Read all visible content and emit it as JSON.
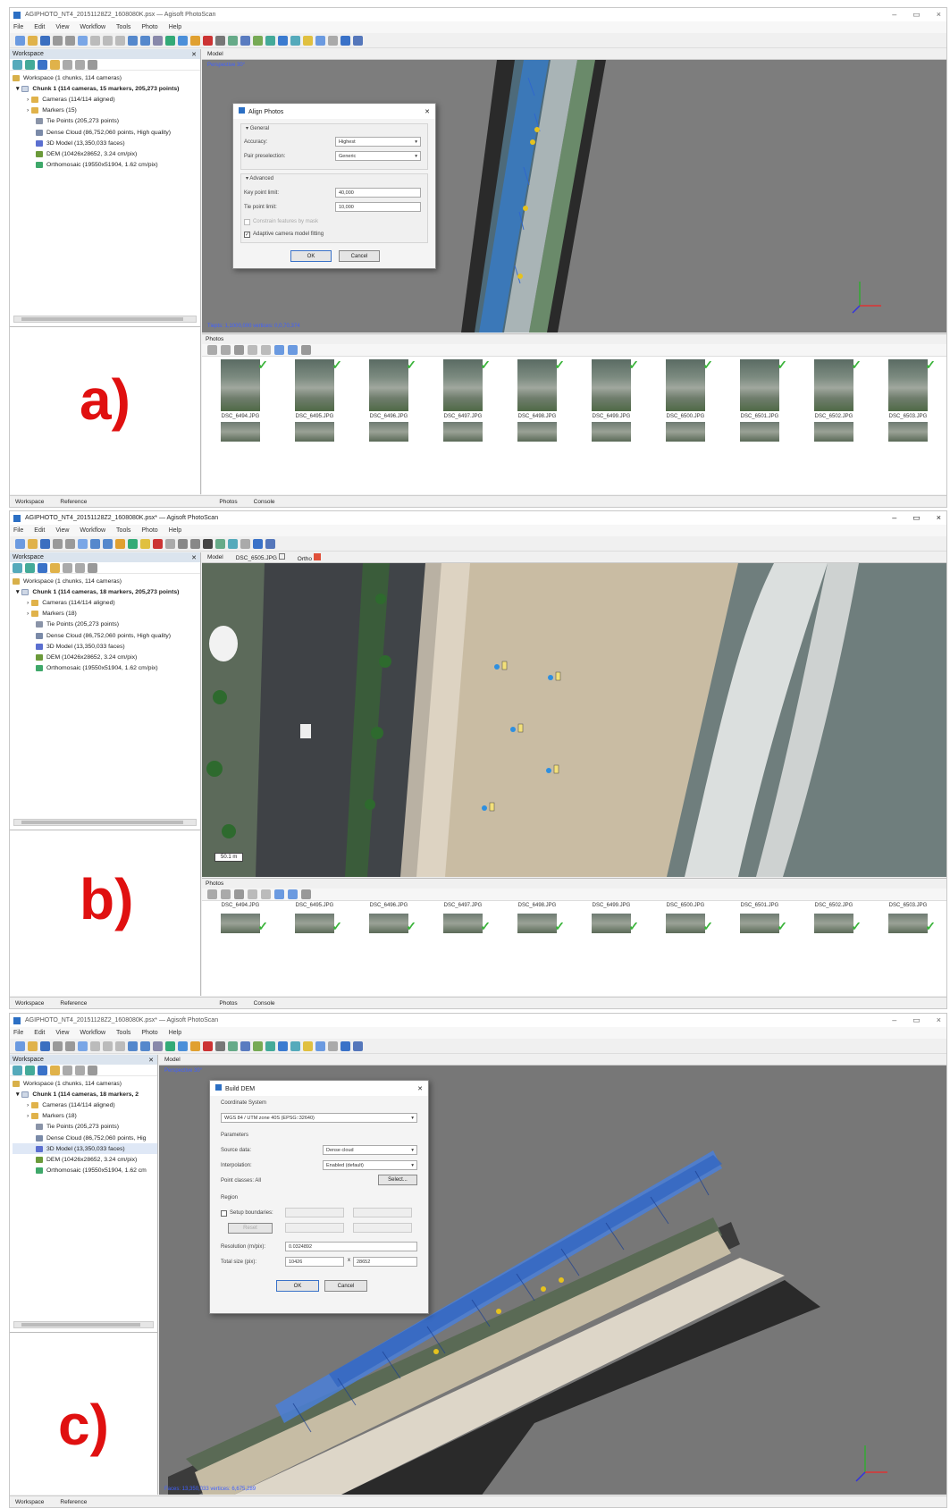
{
  "panels": {
    "a": {
      "title": "AGIPHOTO_NT4_20151128Z2_1608080K.psx — Agisoft PhotoScan",
      "letter": "a)",
      "workspace_label": "Workspace",
      "view_tab": "Model",
      "perspective": "Perspective 30°",
      "status": "Tiepts: 1,1000,000 vertices: 0,0,70,374",
      "tree": [
        "Workspace (1 chunks, 114 cameras)",
        "Chunk 1 (114 cameras, 15 markers, 205,273 points)",
        "Cameras (114/114 aligned)",
        "Markers (15)",
        "Tie Points (205,273 points)",
        "Dense Cloud (86,752,060 points, High quality)",
        "3D Model (13,350,033 faces)",
        "DEM (10426x28652, 3.24 cm/pix)",
        "Orthomosaic (19550x51904, 1.62 cm/pix)"
      ],
      "dialog": {
        "title": "Align Photos",
        "general": "General",
        "accuracy_label": "Accuracy:",
        "accuracy_value": "Highest",
        "pair_label": "Pair preselection:",
        "pair_value": "Generic",
        "advanced": "Advanced",
        "keypoint_label": "Key point limit:",
        "keypoint_value": "40,000",
        "tiepoint_label": "Tie point limit:",
        "tiepoint_value": "10,000",
        "constrain_label": "Constrain features by mask",
        "adaptive_label": "Adaptive camera model fitting",
        "ok": "OK",
        "cancel": "Cancel"
      },
      "photos_label": "Photos",
      "bottom_tabs": [
        "Workspace",
        "Reference"
      ],
      "photo_tabs": [
        "Photos",
        "Console"
      ],
      "photos": [
        "DSC_6494.JPG",
        "DSC_6495.JPG",
        "DSC_6496.JPG",
        "DSC_6497.JPG",
        "DSC_6498.JPG",
        "DSC_6499.JPG",
        "DSC_6500.JPG",
        "DSC_6501.JPG",
        "DSC_6502.JPG",
        "DSC_6503.JPG"
      ]
    },
    "b": {
      "title": "AGIPHOTO_NT4_20151128Z2_1608080K.psx* — Agisoft PhotoScan",
      "letter": "b)",
      "menu": [
        "File",
        "Edit",
        "View",
        "Workflow",
        "Tools",
        "Photo",
        "Help"
      ],
      "workspace_label": "Workspace",
      "tabs": [
        "Model",
        "DSC_6505.JPG",
        "Ortho"
      ],
      "scale": "50.1 m",
      "tree": [
        "Workspace (1 chunks, 114 cameras)",
        "Chunk 1 (114 cameras, 18 markers, 205,273 points)",
        "Cameras (114/114 aligned)",
        "Markers (18)",
        "Tie Points (205,273 points)",
        "Dense Cloud (86,752,060 points, High quality)",
        "3D Model (13,350,033 faces)",
        "DEM (10426x28652, 3.24 cm/pix)",
        "Orthomosaic (19550x51904, 1.62 cm/pix)"
      ],
      "photos_label": "Photos",
      "bottom_tabs": [
        "Workspace",
        "Reference"
      ],
      "photo_tabs": [
        "Photos",
        "Console"
      ],
      "photos": [
        "DSC_6494.JPG",
        "DSC_6495.JPG",
        "DSC_6496.JPG",
        "DSC_6497.JPG",
        "DSC_6498.JPG",
        "DSC_6499.JPG",
        "DSC_6500.JPG",
        "DSC_6501.JPG",
        "DSC_6502.JPG",
        "DSC_6503.JPG"
      ]
    },
    "c": {
      "title": "AGIPHOTO_NT4_20151128Z2_1608080K.psx* — Agisoft PhotoScan",
      "letter": "c)",
      "workspace_label": "Workspace",
      "view_tab": "Model",
      "perspective": "Perspective 30°",
      "status": "Faces: 13,350,033 vertices: 6,675,289",
      "tree": [
        "Workspace (1 chunks, 114 cameras)",
        "Chunk 1 (114 cameras, 18 markers, 2",
        "Cameras (114/114 aligned)",
        "Markers (18)",
        "Tie Points (205,273 points)",
        "Dense Cloud (86,752,060 points, Hig",
        "3D Model (13,350,033 faces)",
        "DEM (10426x28652, 3.24 cm/pix)",
        "Orthomosaic (19550x51904, 1.62 cm"
      ],
      "dialog": {
        "title": "Build DEM",
        "coord_section": "Coordinate System",
        "coord_value": "WGS 84 / UTM zone 40S (EPSG::32640)",
        "params_section": "Parameters",
        "source_label": "Source data:",
        "source_value": "Dense cloud",
        "interp_label": "Interpolation:",
        "interp_value": "Enabled (default)",
        "classes_label": "Point classes:  All",
        "select_btn": "Select...",
        "region_section": "Region",
        "setup_label": "Setup boundaries:",
        "reset_btn": "Reset",
        "res_label": "Resolution (m/pix):",
        "res_value": "0.0324892",
        "size_label": "Total size (pix):",
        "size_w": "10426",
        "size_x": "x",
        "size_h": "28652",
        "ok": "OK",
        "cancel": "Cancel"
      },
      "bottom_tabs": [
        "Workspace",
        "Reference"
      ]
    }
  },
  "menu_faint": [
    "File",
    "Edit",
    "View",
    "Workflow",
    "Tools",
    "Photo",
    "Help"
  ],
  "colors": {
    "letter": "#e01010",
    "accent": "#2b6fc4",
    "check": "#3bb43b"
  }
}
